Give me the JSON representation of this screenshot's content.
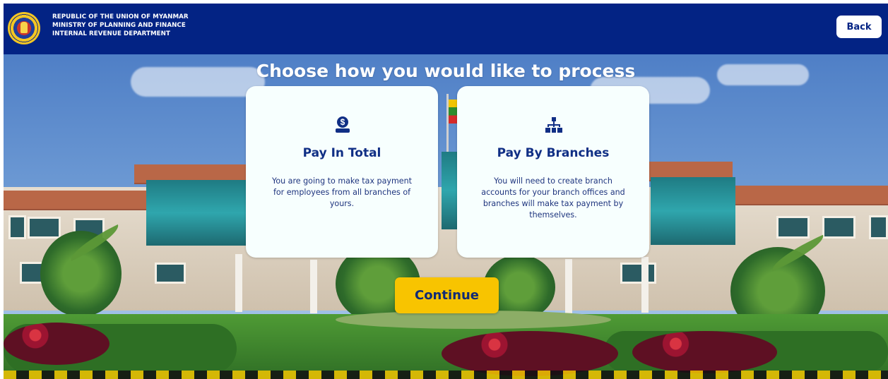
{
  "header": {
    "lines": [
      "REPUBLIC OF THE UNION OF MYANMAR",
      "MINISTRY OF PLANNING AND FINANCE",
      "INTERNAL REVENUE DEPARTMENT"
    ],
    "back_label": "Back",
    "background": "#032384"
  },
  "main": {
    "title": "Choose how you would like to process",
    "cards": [
      {
        "icon": "money-bag-icon",
        "title": "Pay In Total",
        "description": "You are going to make tax payment for employees from all branches of yours."
      },
      {
        "icon": "branches-icon",
        "title": "Pay By Branches",
        "description": "You will need to create branch accounts for your branch offices and branches will make tax payment by themselves."
      }
    ],
    "continue_label": "Continue"
  },
  "colors": {
    "header": "#032384",
    "card": "#f7fffe",
    "accent": "#f8c400",
    "text": "#102f85"
  }
}
